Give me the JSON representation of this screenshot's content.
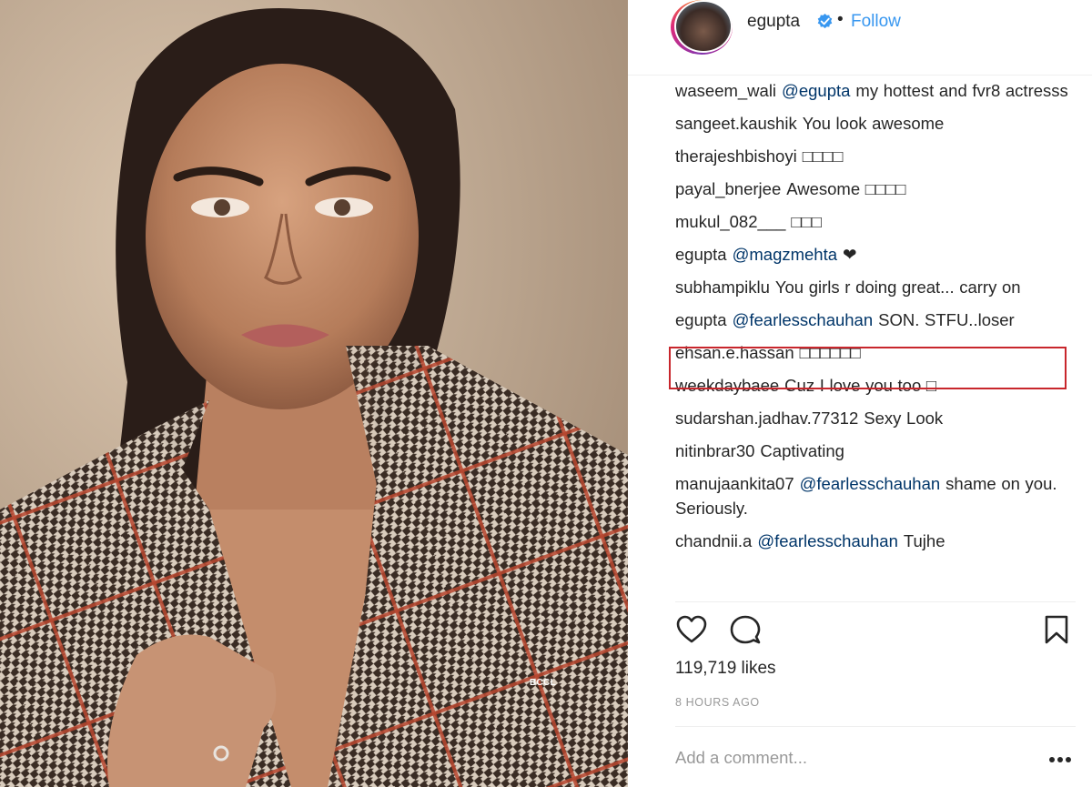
{
  "photo": {
    "watermark": "BCCL"
  },
  "post": {
    "username": "egupta",
    "verified": true,
    "separator": "•",
    "follow_label": "Follow",
    "comments": [
      {
        "user": "waseem_wali",
        "mention": "@egupta",
        "text": "my hottest and fvr8 actresss"
      },
      {
        "user": "sangeet.kaushik",
        "mention": "",
        "text": "You look awesome"
      },
      {
        "user": "therajeshbishoyi",
        "mention": "",
        "text": "□□□□"
      },
      {
        "user": "payal_bnerjee",
        "mention": "",
        "text": "Awesome □□□□"
      },
      {
        "user": "mukul_082___",
        "mention": "",
        "text": "□□□"
      },
      {
        "user": "egupta",
        "mention": "@magzmehta",
        "text": "❤"
      },
      {
        "user": "subhampiklu",
        "mention": "",
        "text": "You girls r doing great... carry on"
      },
      {
        "user": "egupta",
        "mention": "@fearlesschauhan",
        "text": "SON. STFU..loser",
        "highlighted": true
      },
      {
        "user": "ehsan.e.hassan",
        "mention": "",
        "text": "□□□□□□"
      },
      {
        "user": "weekdaybaee",
        "mention": "",
        "text": "Cuz I love you too □"
      },
      {
        "user": "sudarshan.jadhav.77312",
        "mention": "",
        "text": "Sexy Look"
      },
      {
        "user": "nitinbrar30",
        "mention": "",
        "text": "Captivating"
      },
      {
        "user": "manujaankita07",
        "mention": "@fearlesschauhan",
        "text": "shame on you. Seriously."
      },
      {
        "user": "chandnii.a",
        "mention": "@fearlesschauhan",
        "text": "Tujhe"
      }
    ],
    "likes": "119,719 likes",
    "timestamp": "8 HOURS AGO",
    "add_comment_placeholder": "Add a comment...",
    "more_label": "•••"
  },
  "colors": {
    "link": "#3897f0",
    "mention": "#003569",
    "highlight": "#c8262c",
    "text": "#262626",
    "muted": "#999999"
  }
}
